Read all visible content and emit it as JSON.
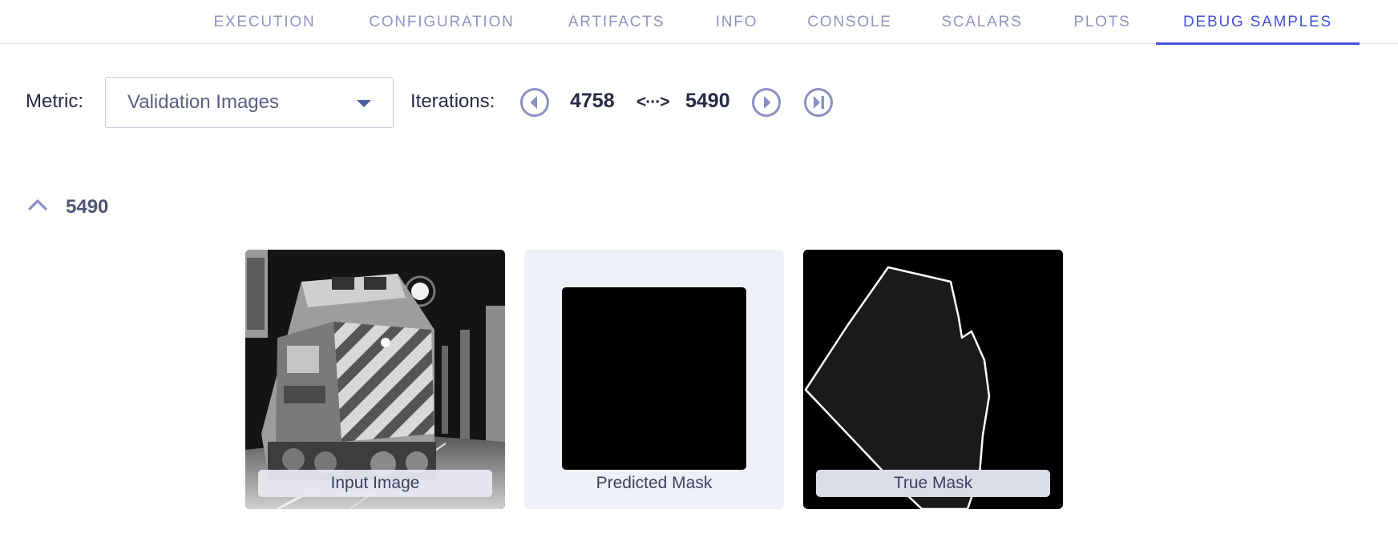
{
  "tabs": [
    {
      "label": "EXECUTION",
      "active": false
    },
    {
      "label": "CONFIGURATION",
      "active": false
    },
    {
      "label": "ARTIFACTS",
      "active": false
    },
    {
      "label": "INFO",
      "active": false
    },
    {
      "label": "CONSOLE",
      "active": false
    },
    {
      "label": "SCALARS",
      "active": false
    },
    {
      "label": "PLOTS",
      "active": false
    },
    {
      "label": "DEBUG SAMPLES",
      "active": true
    }
  ],
  "toolbar": {
    "metric_label": "Metric:",
    "metric_value": "Validation Images",
    "iterations_label": "Iterations:",
    "iteration_from": "4758",
    "range_icon": "<···>",
    "iteration_to": "5490",
    "icons": [
      "previous-circle-icon",
      "next-circle-icon",
      "last-iteration-icon",
      "chevron-down-icon"
    ]
  },
  "group": {
    "title": "5490",
    "expanded": true
  },
  "samples": [
    {
      "caption": "Input Image",
      "kind": "grayscale-photo"
    },
    {
      "caption": "Predicted Mask",
      "kind": "empty-mask"
    },
    {
      "caption": "True Mask",
      "kind": "polygon-mask"
    }
  ],
  "colors": {
    "accent": "#4452e0",
    "tab_inactive": "#8e95c2",
    "text": "#242a48",
    "card_light_bg": "#eef0f9"
  }
}
